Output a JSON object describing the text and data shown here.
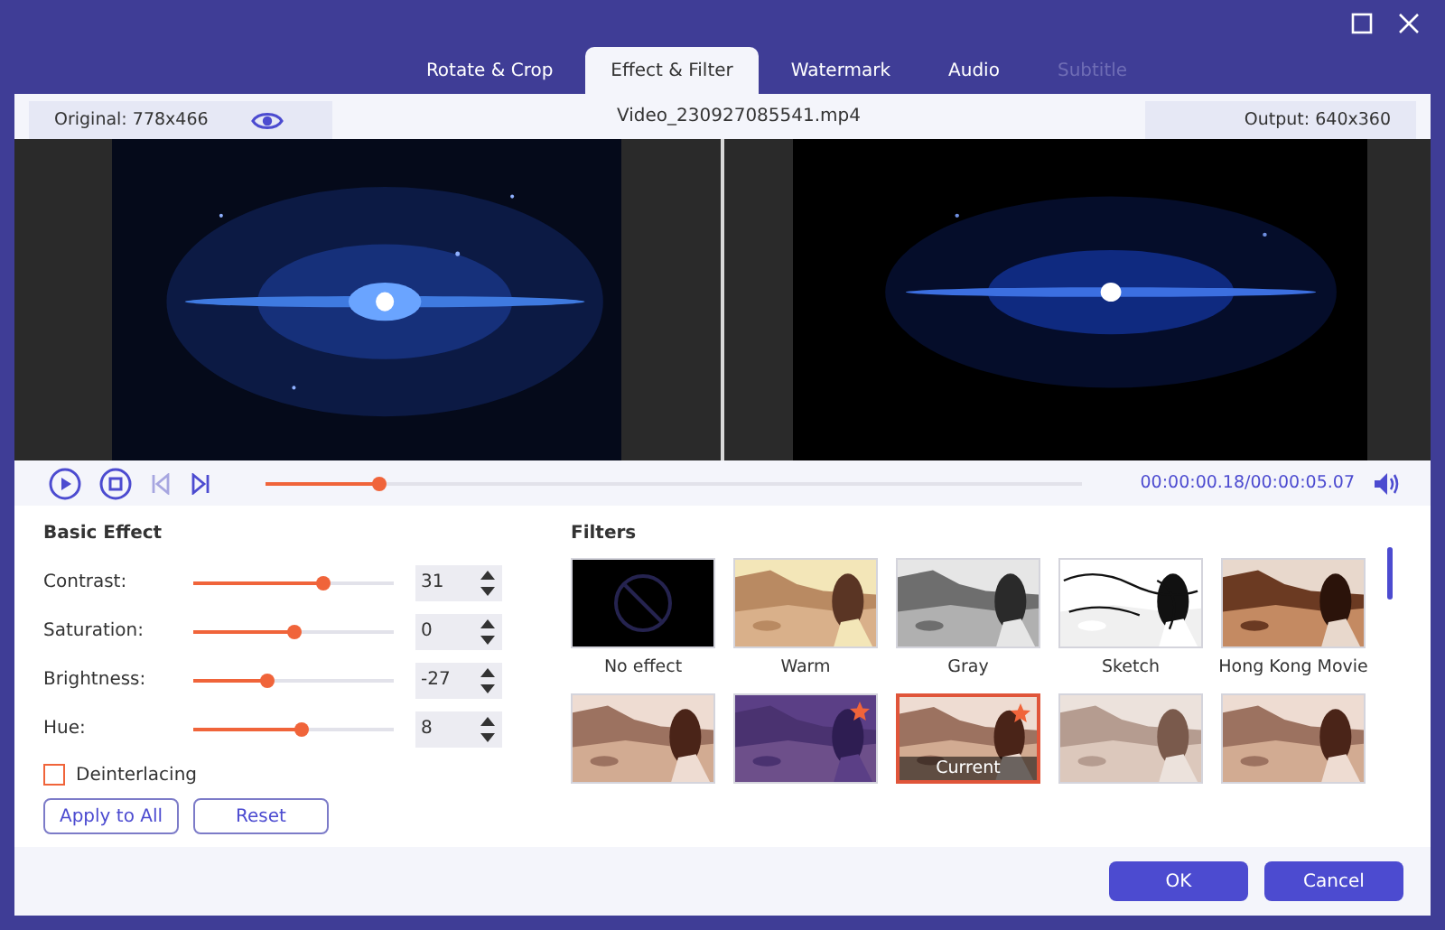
{
  "tabs": [
    {
      "label": "Rotate & Crop",
      "selected": false,
      "disabled": false
    },
    {
      "label": "Effect & Filter",
      "selected": true,
      "disabled": false
    },
    {
      "label": "Watermark",
      "selected": false,
      "disabled": false
    },
    {
      "label": "Audio",
      "selected": false,
      "disabled": false
    },
    {
      "label": "Subtitle",
      "selected": false,
      "disabled": true
    }
  ],
  "info_bar": {
    "original": "Original: 778x466",
    "file_name": "Video_230927085541.mp4",
    "output": "Output: 640x360"
  },
  "player": {
    "level": 0.14,
    "current_time": "00:00:00.18",
    "total_time": "/00:00:05.07"
  },
  "basic_effect": {
    "title": "Basic Effect",
    "sliders": [
      {
        "label": "Contrast:",
        "level": 0.65,
        "value": "31"
      },
      {
        "label": "Saturation:",
        "level": 0.5,
        "value": "0"
      },
      {
        "label": "Brightness:",
        "level": 0.37,
        "value": "-27"
      },
      {
        "label": "Hue:",
        "level": 0.54,
        "value": "8"
      }
    ],
    "deinterlacing": {
      "label": "Deinterlacing",
      "checked": false
    },
    "buttons": [
      "Apply to All",
      "Reset"
    ]
  },
  "filters": {
    "title": "Filters",
    "items": [
      {
        "kind": "none",
        "label": "No effect",
        "selected": false,
        "favorite": false
      },
      {
        "kind": "warm",
        "label": "Warm",
        "selected": false,
        "favorite": false
      },
      {
        "kind": "gray",
        "label": "Gray",
        "selected": false,
        "favorite": false
      },
      {
        "kind": "sketch",
        "label": "Sketch",
        "selected": false,
        "favorite": false
      },
      {
        "kind": "hongkong",
        "label": "Hong Kong Movie",
        "selected": false,
        "favorite": false
      },
      {
        "kind": "plain",
        "selected": false,
        "favorite": false
      },
      {
        "kind": "purple",
        "selected": false,
        "favorite": true
      },
      {
        "kind": "plain",
        "selected": true,
        "favorite": true,
        "badge": "Current"
      },
      {
        "kind": "faded",
        "selected": false,
        "favorite": false
      },
      {
        "kind": "plain",
        "selected": false,
        "favorite": false
      }
    ]
  },
  "footer_buttons": [
    "OK",
    "Cancel"
  ]
}
